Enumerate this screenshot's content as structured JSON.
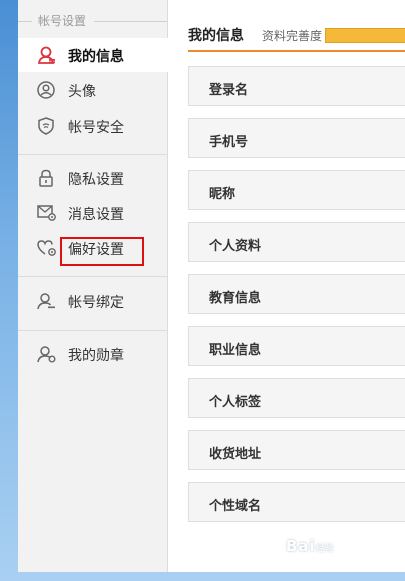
{
  "sidebar": {
    "section_title": "帐号设置",
    "items": [
      {
        "label": "我的信息",
        "icon": "user-icon"
      },
      {
        "label": "头像",
        "icon": "avatar-icon"
      },
      {
        "label": "帐号安全",
        "icon": "shield-icon"
      },
      {
        "label": "隐私设置",
        "icon": "lock-icon"
      },
      {
        "label": "消息设置",
        "icon": "mail-gear-icon"
      },
      {
        "label": "偏好设置",
        "icon": "heart-gear-icon"
      },
      {
        "label": "帐号绑定",
        "icon": "user-link-icon"
      },
      {
        "label": "我的勋章",
        "icon": "medal-user-icon"
      }
    ],
    "active_index": 0,
    "highlighted_index": 5
  },
  "main": {
    "title": "我的信息",
    "completeness_label": "资料完善度",
    "rows": [
      "登录名",
      "手机号",
      "昵称",
      "个人资料",
      "教育信息",
      "职业信息",
      "个人标签",
      "收货地址",
      "个性域名"
    ]
  },
  "watermark": {
    "text": "Bai",
    "suffix": "经验"
  },
  "colors": {
    "accent": "#f08a2a",
    "active_icon": "#d9363e",
    "progress": "#f5b838",
    "highlight_box": "#e01010"
  }
}
